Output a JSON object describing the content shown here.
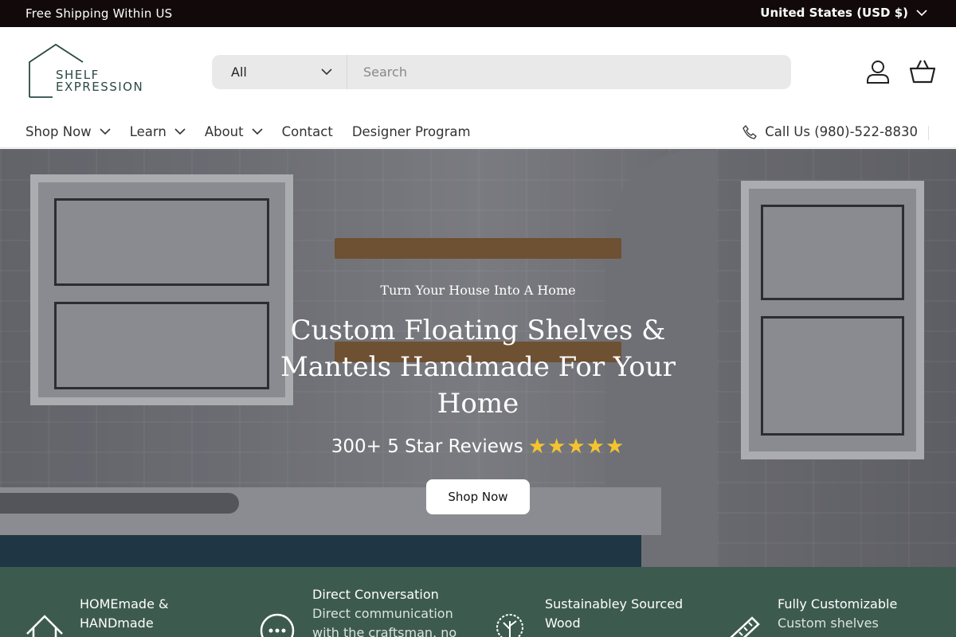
{
  "announcement": {
    "shipping": "Free Shipping Within US",
    "country": "United States (USD $)"
  },
  "logo": {
    "line1": "SHELF",
    "line2": "EXPRESSION"
  },
  "search": {
    "category": "All",
    "placeholder": "Search"
  },
  "nav": {
    "items": [
      "Shop Now",
      "Learn",
      "About",
      "Contact",
      "Designer Program"
    ],
    "phone": "Call Us (980)-522-8830"
  },
  "hero": {
    "subtitle": "Turn Your House Into A Home",
    "title": "Custom Floating Shelves & Mantels Handmade For Your Home",
    "reviews": "300+ 5 Star Reviews",
    "stars": "★★★★★",
    "button": "Shop Now"
  },
  "features": [
    {
      "title_line1": "HOMEmade &",
      "title_line2": "HANDmade",
      "icon": "house-icon"
    },
    {
      "title": "Direct Conversation",
      "desc_line1": "Direct communication",
      "desc_line2": "with the craftsman, no",
      "icon": "chat-icon"
    },
    {
      "title_line1": "Sustainabley Sourced",
      "title_line2": "Wood",
      "icon": "tree-icon"
    },
    {
      "title": "Fully Customizable",
      "desc_line1": "Custom shelves",
      "icon": "ruler-icon"
    }
  ],
  "colors": {
    "announcement_bg": "#120a0a",
    "features_bg": "#3d5a4f",
    "logo_green": "#2a4a44"
  }
}
